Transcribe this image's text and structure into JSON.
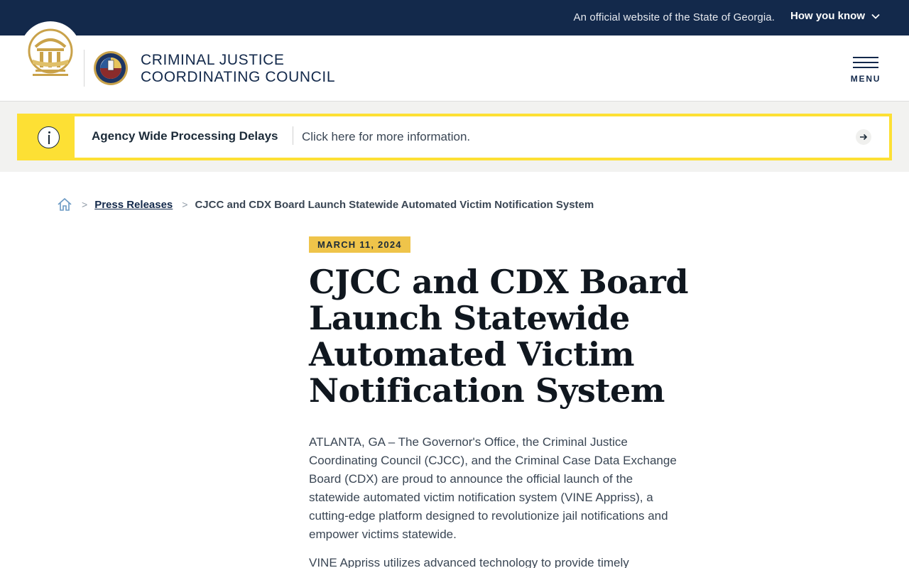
{
  "gov_banner": {
    "official_text": "An official website of the State of Georgia.",
    "how_you_know_label": "How you know"
  },
  "header": {
    "agency_name_line1": "CRIMINAL JUSTICE",
    "agency_name_line2": "COORDINATING COUNCIL",
    "menu_label": "MENU"
  },
  "alert": {
    "title": "Agency Wide Processing Delays",
    "message": "Click here for more information."
  },
  "breadcrumb": {
    "items": [
      {
        "label": "Press Releases"
      }
    ],
    "current": "CJCC and CDX Board Launch Statewide Automated Victim Notification System"
  },
  "article": {
    "date": "MARCH 11, 2024",
    "title": "CJCC and CDX Board Launch Statewide Automated Victim Notification System",
    "paragraphs": [
      "ATLANTA, GA – The Governor's Office, the Criminal Justice Coordinating Council (CJCC), and the Criminal Case Data Exchange Board (CDX) are proud to announce the official launch of the statewide automated victim notification system (VINE Appriss), a cutting-edge platform designed to revolutionize jail notifications and empower victims statewide.",
      "VINE Appriss utilizes advanced technology to provide timely"
    ]
  },
  "colors": {
    "banner_bg": "#13294b",
    "alert_yellow": "#fde034",
    "date_badge": "#efc44a",
    "text_dark": "#10171f"
  }
}
